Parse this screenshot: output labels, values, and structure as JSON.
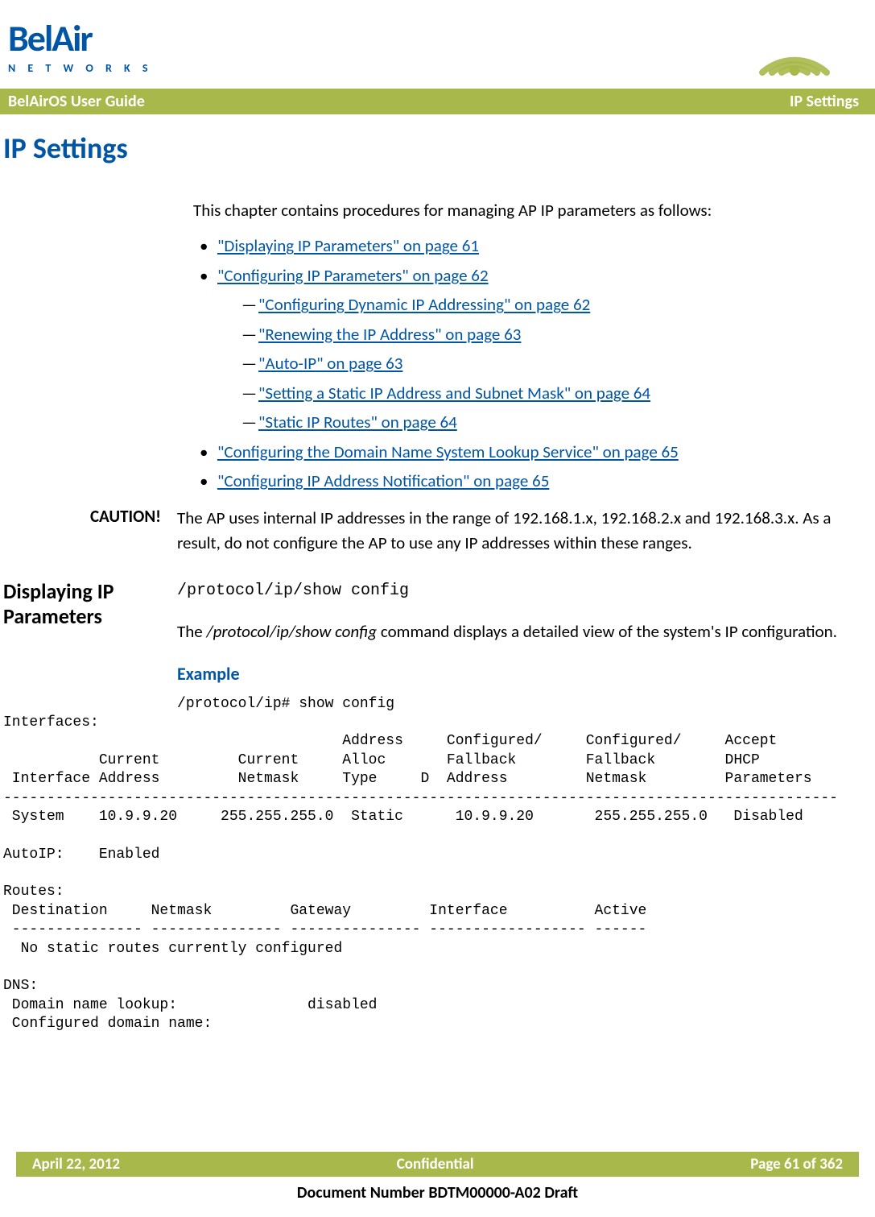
{
  "brand": {
    "name": "BelAir",
    "sub": "N E T W O R K S"
  },
  "header": {
    "left": "BelAirOS User Guide",
    "right": "IP Settings"
  },
  "chapter_title": "IP Settings",
  "intro": "This chapter contains procedures for managing AP IP parameters as follows:",
  "toc": {
    "items": [
      {
        "label": "\"Displaying IP Parameters\" on page 61"
      },
      {
        "label": "\"Configuring IP Parameters\" on page 62",
        "sub": [
          "\"Configuring Dynamic IP Addressing\" on page 62",
          "\"Renewing the IP Address\" on page 63",
          "\"Auto-IP\" on page 63",
          "\"Setting a Static IP Address and Subnet Mask\" on page 64",
          "\"Static IP Routes\" on page 64"
        ]
      },
      {
        "label": "\"Configuring the Domain Name System Lookup Service\" on page 65"
      },
      {
        "label": "\"Configuring IP Address Notification\" on page 65"
      }
    ]
  },
  "caution": {
    "label": "CAUTION!",
    "text": "The AP uses internal IP addresses in the range of 192.168.1.x, 192.168.2.x and 192.168.3.x. As a result, do not configure the AP to use any IP addresses within these ranges."
  },
  "section": {
    "heading": "Displaying IP Parameters",
    "command": "/protocol/ip/show config",
    "desc_pre": "The ",
    "desc_cmd": "/protocol/ip/show config",
    "desc_post": " command displays a detailed view of the system's IP configuration.",
    "example_heading": "Example"
  },
  "terminal": "                    /protocol/ip# show config\nInterfaces:\n                                       Address     Configured/     Configured/     Accept\n           Current         Current     Alloc       Fallback        Fallback        DHCP\n Interface Address         Netmask     Type     D  Address         Netmask         Parameters\n------------------------------------------------------------------------------------------------\n System    10.9.9.20     255.255.255.0  Static      10.9.9.20       255.255.255.0   Disabled\n\nAutoIP:    Enabled\n\nRoutes:\n Destination     Netmask         Gateway         Interface          Active\n --------------- --------------- --------------- ------------------ ------\n  No static routes currently configured\n\nDNS:\n Domain name lookup:               disabled\n Configured domain name:",
  "footer": {
    "left": "April 22, 2012",
    "center": "Confidential",
    "right": "Page 61 of 362"
  },
  "doc_number": "Document Number BDTM00000-A02 Draft"
}
